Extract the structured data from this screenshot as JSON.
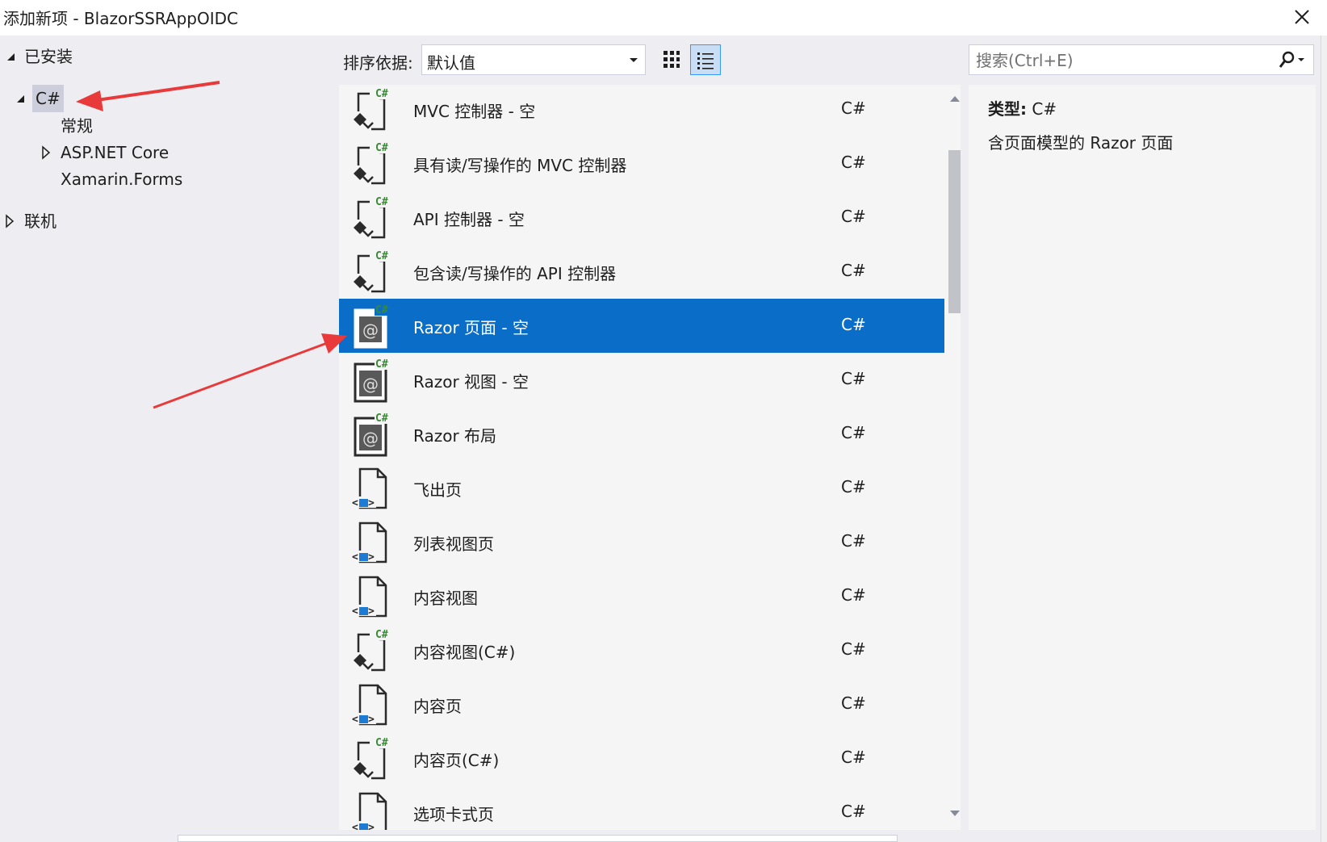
{
  "window": {
    "title": "添加新项 - BlazorSSRAppOIDC",
    "close_icon": "close-icon"
  },
  "tree": {
    "installed": "已安装",
    "csharp": "C#",
    "general": "常规",
    "aspnet_core": "ASP.NET Core",
    "xamarin_forms": "Xamarin.Forms",
    "online": "联机"
  },
  "toolbar": {
    "sort_label": "排序依据:",
    "sort_value": "默认值",
    "grid_view_icon": "grid-view-icon",
    "list_view_icon": "list-view-icon"
  },
  "search": {
    "placeholder": "搜索(Ctrl+E)",
    "icon": "search-icon"
  },
  "items": [
    {
      "name": "MVC 控制器 - 空",
      "lang": "C#",
      "icon": "csharp-class-icon"
    },
    {
      "name": "具有读/写操作的 MVC 控制器",
      "lang": "C#",
      "icon": "csharp-class-icon"
    },
    {
      "name": "API 控制器 - 空",
      "lang": "C#",
      "icon": "csharp-class-icon"
    },
    {
      "name": "包含读/写操作的 API 控制器",
      "lang": "C#",
      "icon": "csharp-class-icon"
    },
    {
      "name": "Razor 页面 - 空",
      "lang": "C#",
      "icon": "razor-icon",
      "selected": true
    },
    {
      "name": "Razor 视图 - 空",
      "lang": "C#",
      "icon": "razor-icon"
    },
    {
      "name": "Razor 布局",
      "lang": "C#",
      "icon": "razor-icon"
    },
    {
      "name": "飞出页",
      "lang": "C#",
      "icon": "xaml-page-icon"
    },
    {
      "name": "列表视图页",
      "lang": "C#",
      "icon": "xaml-page-icon"
    },
    {
      "name": "内容视图",
      "lang": "C#",
      "icon": "xaml-page-icon"
    },
    {
      "name": "内容视图(C#)",
      "lang": "C#",
      "icon": "csharp-class-icon"
    },
    {
      "name": "内容页",
      "lang": "C#",
      "icon": "xaml-page-icon"
    },
    {
      "name": "内容页(C#)",
      "lang": "C#",
      "icon": "csharp-class-icon"
    },
    {
      "name": "选项卡式页",
      "lang": "C#",
      "icon": "xaml-page-icon"
    }
  ],
  "details": {
    "type_label": "类型:",
    "type_value": "C#",
    "description": "含页面模型的 Razor 页面"
  },
  "colors": {
    "selection": "#0a6ec8",
    "csharp_badge": "#388a34",
    "annotation_arrow": "#e83a3a"
  }
}
